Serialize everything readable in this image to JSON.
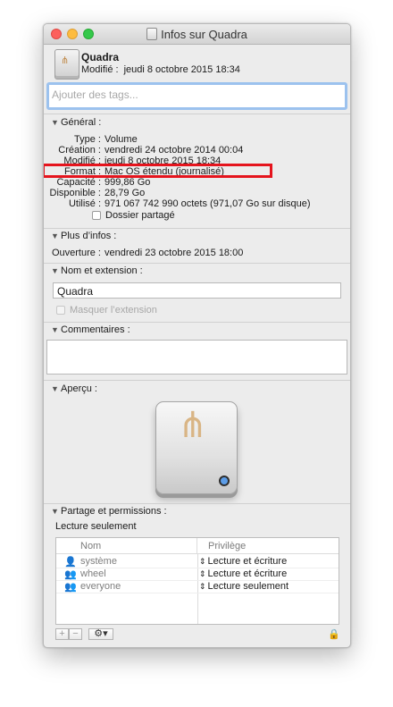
{
  "window": {
    "title": "Infos sur Quadra"
  },
  "header": {
    "name": "Quadra",
    "modified_label": "Modifié :",
    "modified_value": "jeudi 8 octobre 2015 18:34"
  },
  "tags": {
    "placeholder": "Ajouter des tags..."
  },
  "general": {
    "title": "Général :",
    "rows": [
      {
        "label": "Type :",
        "value": "Volume"
      },
      {
        "label": "Création :",
        "value": "vendredi 24 octobre 2014 00:04"
      },
      {
        "label": "Modifié :",
        "value": "jeudi 8 octobre 2015 18:34"
      },
      {
        "label": "Format :",
        "value": "Mac OS étendu (journalisé)"
      },
      {
        "label": "Capacité :",
        "value": "999,86 Go"
      },
      {
        "label": "Disponible :",
        "value": "28,79 Go"
      },
      {
        "label": "Utilisé :",
        "value": "971 067 742 990 octets (971,07 Go sur disque)"
      }
    ],
    "shared_folder_label": "Dossier partagé"
  },
  "more_info": {
    "title": "Plus d’infos :",
    "opening_label": "Ouverture :",
    "opening_value": "vendredi 23 octobre 2015 18:00"
  },
  "name_extension": {
    "title": "Nom et extension :",
    "name_value": "Quadra",
    "hide_extension_label": "Masquer l’extension"
  },
  "comments": {
    "title": "Commentaires :"
  },
  "preview": {
    "title": "Aperçu :"
  },
  "sharing": {
    "title": "Partage et permissions :",
    "status": "Lecture seulement",
    "columns": {
      "name": "Nom",
      "privilege": "Privilège"
    },
    "rows": [
      {
        "icon": "single-user-icon",
        "name": "système",
        "privilege": "Lecture et écriture"
      },
      {
        "icon": "group-icon",
        "name": "wheel",
        "privilege": "Lecture et écriture"
      },
      {
        "icon": "everyone-icon",
        "name": "everyone",
        "privilege": "Lecture seulement"
      }
    ]
  },
  "colors": {
    "highlight": "#e5141d",
    "focus_ring": "#9cc2ee",
    "close": "#fc605c",
    "minimize": "#fdbc40",
    "maximize": "#34c84a"
  }
}
